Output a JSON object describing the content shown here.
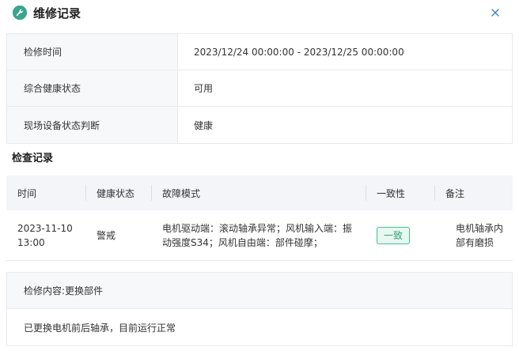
{
  "dialog": {
    "title": "维修记录",
    "close_icon": "close-icon",
    "logo_icon": "wrench-icon",
    "accent_color": "#3aa58c"
  },
  "info": {
    "rows": [
      {
        "label": "检修时间",
        "value": "2023/12/24 00:00:00 - 2023/12/25 00:00:00"
      },
      {
        "label": "综合健康状态",
        "value": "可用"
      },
      {
        "label": "现场设备状态判断",
        "value": "健康"
      }
    ]
  },
  "records": {
    "title": "检查记录",
    "columns": [
      "时间",
      "健康状态",
      "故障模式",
      "一致性",
      "备注"
    ],
    "rows": [
      {
        "time_line1": "2023-11-10",
        "time_line2": "13:00",
        "health": "警戒",
        "fault_line1": "电机驱动端：滚动轴承异常；风机输入端：振",
        "fault_line2": "动强度S34；风机自由端：部件碰摩；",
        "consistency": "一致",
        "note_line1": "电机轴承内",
        "note_line2": "部有磨损"
      }
    ]
  },
  "detail": {
    "heading": "检修内容:更换部件",
    "body": "已更换电机前后轴承，目前运行正常"
  }
}
